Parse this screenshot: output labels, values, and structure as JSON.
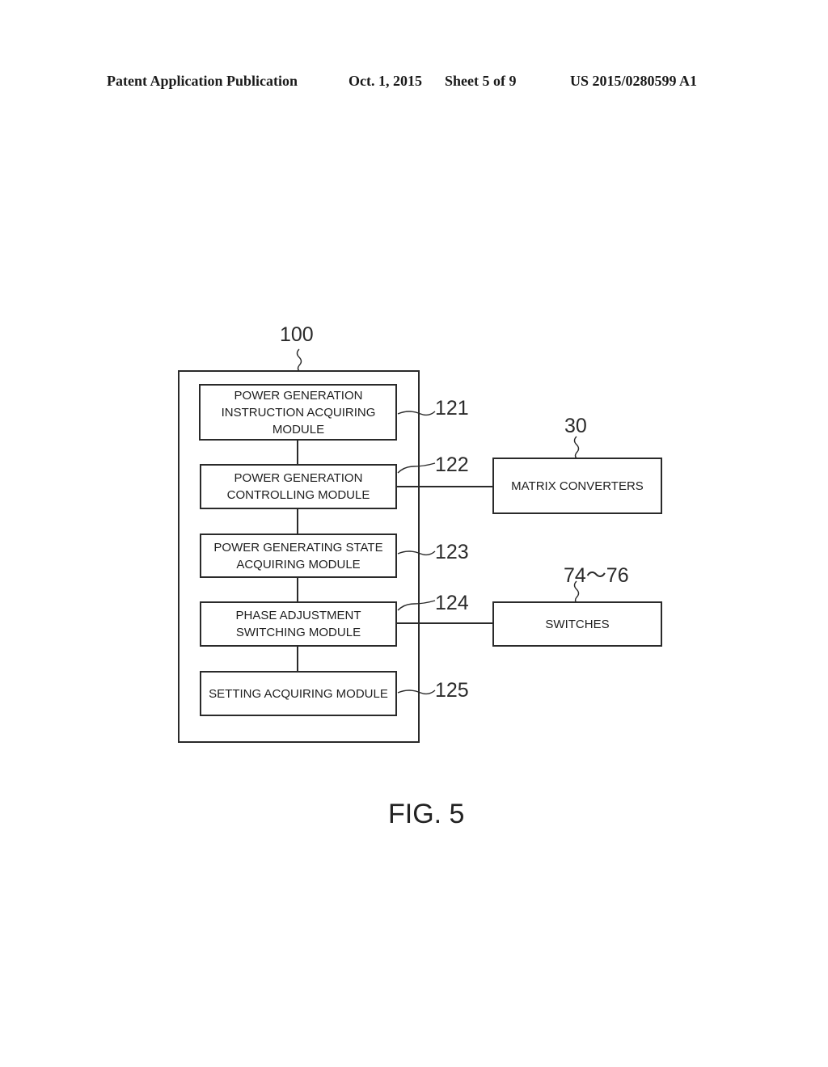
{
  "header": {
    "publication_type": "Patent Application Publication",
    "date": "Oct. 1, 2015",
    "sheet": "Sheet 5 of 9",
    "patent_number": "US 2015/0280599 A1"
  },
  "diagram": {
    "controller": {
      "ref": "100",
      "modules": [
        {
          "ref": "121",
          "label": "POWER GENERATION\nINSTRUCTION ACQUIRING\nMODULE"
        },
        {
          "ref": "122",
          "label": "POWER GENERATION\nCONTROLLING MODULE"
        },
        {
          "ref": "123",
          "label": "POWER GENERATING STATE\nACQUIRING MODULE"
        },
        {
          "ref": "124",
          "label": "PHASE ADJUSTMENT\nSWITCHING MODULE"
        },
        {
          "ref": "125",
          "label": "SETTING ACQUIRING MODULE"
        }
      ]
    },
    "external": [
      {
        "ref": "30",
        "label": "MATRIX CONVERTERS",
        "connected_to": "122"
      },
      {
        "ref": "74～76",
        "label": "SWITCHES",
        "connected_to": "124"
      }
    ]
  },
  "figure_label": "FIG. 5"
}
